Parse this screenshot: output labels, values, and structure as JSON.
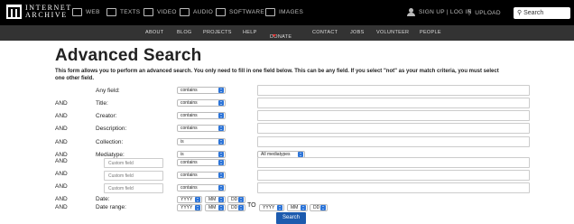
{
  "topbar": {
    "logo_line1": "INTERNET",
    "logo_line2": "ARCHIVE",
    "nav": [
      {
        "label": "WEB",
        "icon": "web-icon"
      },
      {
        "label": "TEXTS",
        "icon": "texts-icon"
      },
      {
        "label": "VIDEO",
        "icon": "video-icon"
      },
      {
        "label": "AUDIO",
        "icon": "audio-icon"
      },
      {
        "label": "SOFTWARE",
        "icon": "software-icon"
      },
      {
        "label": "IMAGES",
        "icon": "images-icon"
      }
    ],
    "account": "SIGN UP | LOG IN",
    "upload": "UPLOAD",
    "search_placeholder": "Search"
  },
  "subnav": [
    "ABOUT",
    "BLOG",
    "PROJECTS",
    "HELP",
    "DONATE",
    "CONTACT",
    "JOBS",
    "VOLUNTEER",
    "PEOPLE"
  ],
  "page": {
    "title": "Advanced Search",
    "intro": "This form allows you to perform an advanced search. You only need to fill in one field below. This can be any field. If you select \"not\" as your match criteria, you must select one other field."
  },
  "rows": [
    {
      "conj": "",
      "label": "Any field:",
      "op": "contains"
    },
    {
      "conj": "AND",
      "label": "Title:",
      "op": "contains"
    },
    {
      "conj": "AND",
      "label": "Creator:",
      "op": "contains"
    },
    {
      "conj": "AND",
      "label": "Description:",
      "op": "contains"
    },
    {
      "conj": "AND",
      "label": "Collection:",
      "op": "is"
    },
    {
      "conj": "AND",
      "label": "Mediatype:",
      "op": "is",
      "value_select": "All mediatypes"
    },
    {
      "conj": "AND",
      "custom": "Custom field",
      "op": "contains"
    },
    {
      "conj": "AND",
      "custom": "Custom field",
      "op": "contains"
    },
    {
      "conj": "AND",
      "custom": "Custom field",
      "op": "contains"
    },
    {
      "conj": "AND",
      "label": "Date:"
    },
    {
      "conj": "AND",
      "label": "Date range:"
    }
  ],
  "date": {
    "yyyy": "YYYY",
    "mm": "MM",
    "dd": "DD",
    "to": "TO"
  },
  "search_button": "Search"
}
